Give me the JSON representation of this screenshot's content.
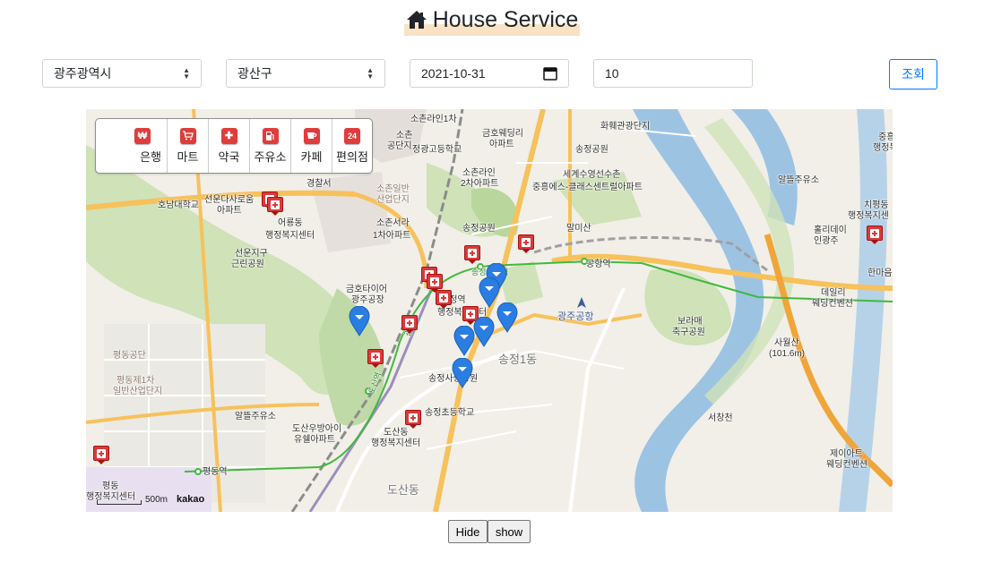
{
  "header": {
    "title": "House Service",
    "icon": "house-icon"
  },
  "filters": {
    "city": "광주광역시",
    "district": "광산구",
    "date": "2021-10-31",
    "count": "10",
    "query_button": "조회"
  },
  "categories": [
    {
      "label": "은행",
      "icon": "bank-icon",
      "glyph": "₩"
    },
    {
      "label": "마트",
      "icon": "cart-icon",
      "glyph": "🛒"
    },
    {
      "label": "약국",
      "icon": "pharmacy-icon",
      "glyph": "✚"
    },
    {
      "label": "주유소",
      "icon": "gas-station-icon",
      "glyph": "⛽"
    },
    {
      "label": "카페",
      "icon": "coffee-icon",
      "glyph": "☕"
    },
    {
      "label": "편의점",
      "icon": "convenience-store-icon",
      "glyph": "24"
    }
  ],
  "map": {
    "labels": {
      "a1": "소촌라인1차",
      "a2": "소촌",
      "a3": "공단지",
      "a4": "정광고등학교",
      "a5": "금호웨딩리",
      "a6": "아파트",
      "a7": "화훼관광단지",
      "a8": "송정공원",
      "a9": "중흥",
      "a10": "행정복",
      "a11": "소촌일반",
      "a12": "산업단지",
      "a13": "소촌라인",
      "a14": "2차아파트",
      "a15": "세계수영선수촌",
      "a16": "중흥에스-클래스센트럴아파트",
      "a17": "선운다사로움",
      "a18": "아파트",
      "a19": "경찰서",
      "a20": "호남대학교",
      "a21": "어룡동",
      "a22": "행정복지센터",
      "a23": "소촌서라",
      "a24": "1차아파트",
      "a25": "송정공원",
      "a26": "말미산",
      "a27": "알뜰주유소",
      "a28": "치평동",
      "a29": "행정복지센",
      "a30": "홀리데이",
      "a31": "인광주",
      "a32": "선운지구",
      "a33": "근린공원",
      "a34": "금호타이어",
      "a35": "광주공장",
      "a36": "송정역",
      "a37": "공항역",
      "a38": "광주공항",
      "a39": "데일리",
      "a40": "웨딩컨벤션",
      "a41": "한마음",
      "a42": "행정복지센터",
      "a43": "보라매",
      "a44": "축구공원",
      "a45": "사월산",
      "a46": "(101.6m)",
      "a47": "평동공단",
      "a48": "평동제1차",
      "a49": "일반산업단지",
      "a50": "송정1동",
      "a51": "송정사랑공원",
      "a52": "알뜰주유소",
      "a53": "송정초등학교",
      "a54": "도산우방아이",
      "a55": "유쉘아파트",
      "a56": "도산동",
      "a57": "행정복지센터",
      "a58": "평동역",
      "a59": "평동",
      "a60": "행정복지센터",
      "a61": "도산동",
      "a62": "서창천",
      "a63": "제이아트",
      "a64": "웨딩컨벤션",
      "a65": "광산역",
      "a66": "도산역",
      "a67": "송정공원역"
    },
    "scale_label": "500m",
    "brand": "kakao"
  },
  "buttons": {
    "hide": "Hide",
    "show": "show"
  },
  "colors": {
    "primary": "#007bff",
    "pharmacy_marker": "#d83b3b",
    "house_marker": "#2a7de1",
    "title_highlight": "#f9e3c4"
  }
}
